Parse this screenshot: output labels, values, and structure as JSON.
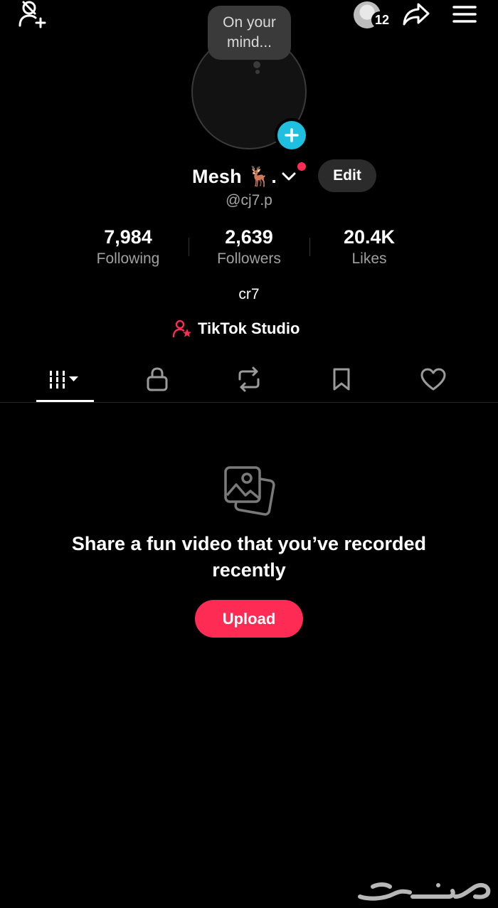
{
  "header": {
    "activity_badge_count": "12"
  },
  "profile": {
    "avatar_prompt": "On your mind...",
    "name": "Mesh 🦌.",
    "username": "@cj7.p",
    "edit_label": "Edit",
    "bio": "cr7",
    "studio_label": "TikTok Studio"
  },
  "stats": [
    {
      "value": "7,984",
      "label": "Following"
    },
    {
      "value": "2,639",
      "label": "Followers"
    },
    {
      "value": "20.4K",
      "label": "Likes"
    }
  ],
  "tabs": [
    {
      "icon": "videos-grid-icon",
      "selected": true
    },
    {
      "icon": "lock-icon",
      "selected": false
    },
    {
      "icon": "repost-icon",
      "selected": false
    },
    {
      "icon": "bookmark-icon",
      "selected": false
    },
    {
      "icon": "heart-icon",
      "selected": false
    }
  ],
  "empty_state": {
    "message": "Share a fun video that you’ve recorded recently",
    "upload_label": "Upload"
  },
  "colors": {
    "accent": "#fe2c55",
    "avatar_add": "#1fbfe0",
    "background": "#000000",
    "secondary_text": "#a0a0a0"
  }
}
